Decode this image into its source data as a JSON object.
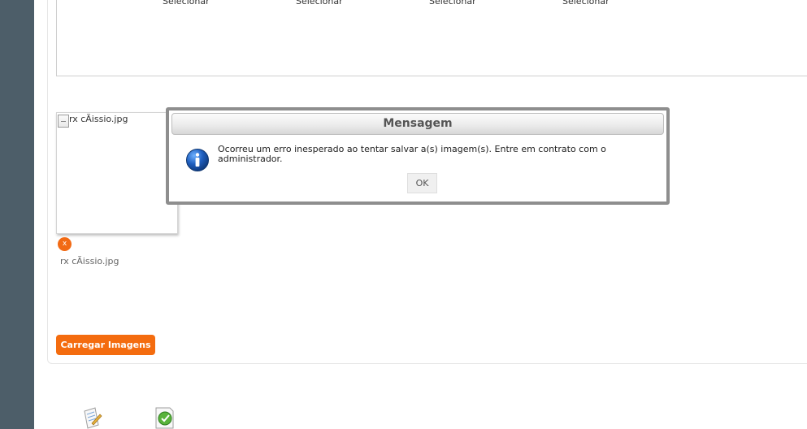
{
  "select_links": [
    "Selecionar",
    "Selecionar",
    "Selecionar",
    "Selecionar"
  ],
  "thumbnail": {
    "alt_text": "rx cÃissio.jpg",
    "caption": "rx cÃissio.jpg",
    "remove_label": "x"
  },
  "upload": {
    "label": "Carregar Imagens"
  },
  "modal": {
    "title": "Mensagem",
    "message": "Ocorreu um erro inesperado ao tentar salvar a(s) imagem(s). Entre em contrato com o administrador.",
    "ok_label": "OK"
  },
  "colors": {
    "rail": "#4d5e69",
    "accent": "#f46c0f",
    "modal_border": "#8e8e8e",
    "info_icon": "#1f5fbf"
  },
  "icons": [
    "broken-image-icon",
    "document-edit-icon",
    "checkmark-icon",
    "info-icon"
  ]
}
